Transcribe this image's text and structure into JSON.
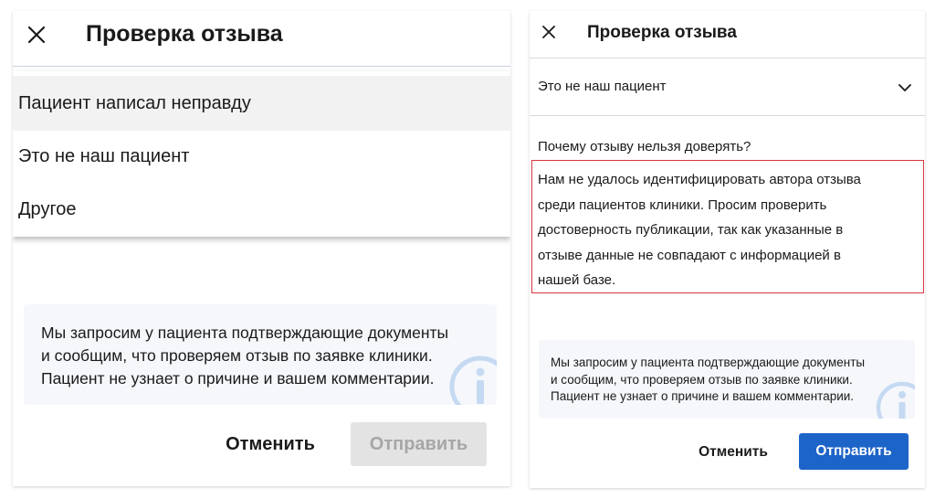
{
  "left_panel": {
    "title": "Проверка отзыва",
    "dropdown_options": [
      "Пациент написал неправду",
      "Это не наш пациент",
      "Другое"
    ],
    "info_lines": [
      "Мы запросим у пациента подтверждающие документы",
      "и сообщим, что проверяем отзыв по заявке клиники.",
      "Пациент не узнает о причине и вашем комментарии."
    ],
    "cancel_label": "Отменить",
    "send_label": "Отправить",
    "send_enabled": false
  },
  "right_panel": {
    "title": "Проверка отзыва",
    "selected_reason": "Это не наш пациент",
    "question_label": "Почему отзыву нельзя доверять?",
    "comment_lines": [
      "Нам не удалось идентифицировать автора отзыва",
      "среди пациентов клиники. Просим проверить",
      "достоверность публикации, так как указанные в",
      "отзыве данные не совпадают с информацией в",
      "нашей базе."
    ],
    "info_lines": [
      "Мы запросим у пациента подтверждающие документы",
      "и сообщим, что проверяем отзыв по заявке клиники.",
      "Пациент не узнает о причине и вашем комментарии."
    ],
    "cancel_label": "Отменить",
    "send_label": "Отправить",
    "send_enabled": true
  },
  "icons": {
    "close": "close-icon",
    "chevron": "chevron-down-icon",
    "info": "info-icon"
  },
  "colors": {
    "primary_button": "#1d64c8",
    "disabled_button": "#e3e3e3",
    "disabled_text": "#a6a6a6",
    "error_border": "#d9363e",
    "info_background": "#f5f7fb",
    "info_icon": "#c5d9f2"
  }
}
